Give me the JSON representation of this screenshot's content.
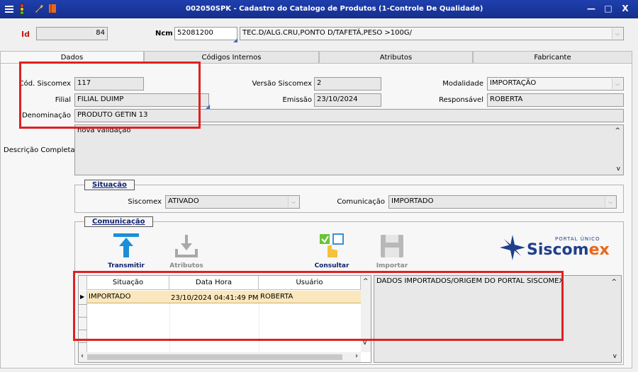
{
  "window": {
    "title": "002050SPK - Cadastro do Catalogo de Produtos (1-Controle De Qualidade)",
    "min": "—",
    "max": "□",
    "close": "X"
  },
  "header": {
    "id_label": "Id",
    "id_value": "84",
    "ncm_label": "Ncm",
    "ncm_code": "52081200",
    "ncm_desc": "TEC.D/ALG.CRU,PONTO D/TAFETÁ,PESO >100G/"
  },
  "tabs": [
    {
      "label": "Dados",
      "active": true
    },
    {
      "label": "Códigos Internos"
    },
    {
      "label": "Atributos"
    },
    {
      "label": "Fabricante"
    }
  ],
  "form": {
    "cod_siscomex_label": "Cód. Siscomex",
    "cod_siscomex": "117",
    "versao_label": "Versão Siscomex",
    "versao": "2",
    "modalidade_label": "Modalidade",
    "modalidade": "IMPORTAÇÃO",
    "filial_label": "Filial",
    "filial": "FILIAL DUIMP",
    "emissao_label": "Emissão",
    "emissao": "23/10/2024",
    "responsavel_label": "Responsável",
    "responsavel": "ROBERTA",
    "denominacao_label": "Denominação",
    "denominacao": "PRODUTO GETIN 13",
    "descricao_label": "Descrição Completa",
    "descricao": "nova validação"
  },
  "situacao": {
    "title": "Situação",
    "siscomex_label": "Siscomex",
    "siscomex": "ATIVADO",
    "comunicacao_label": "Comunicação",
    "comunicacao": "IMPORTADO"
  },
  "comunicacao": {
    "title": "Comunicação",
    "buttons": {
      "transmitir": "Transmitir",
      "atributos": "Atributos",
      "consultar": "Consultar",
      "importar": "Importar"
    },
    "logo_small": "PORTAL ÚNICO",
    "logo_main_a": "Siscom",
    "logo_main_b": "ex",
    "grid": {
      "columns": [
        "Situação",
        "Data Hora",
        "Usuário"
      ],
      "rows": [
        [
          "IMPORTADO",
          "23/10/2024 04:41:49 PM",
          "ROBERTA"
        ]
      ]
    },
    "message": "DADOS IMPORTADOS/ORIGEM DO PORTAL SISCOMEX"
  },
  "colors": {
    "titlebar": "#1f3fae",
    "highlight": "#e02020",
    "selected_row": "#fbe7bd",
    "group_title": "#11216f"
  }
}
